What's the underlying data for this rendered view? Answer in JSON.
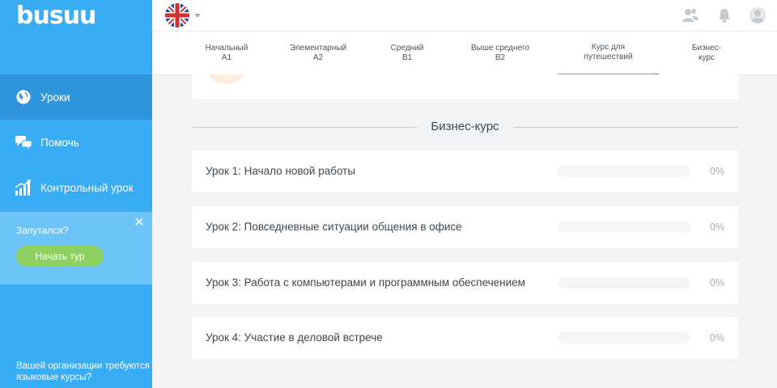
{
  "app": {
    "logo": "busuu"
  },
  "sidebar": {
    "items": [
      {
        "label": "Уроки",
        "icon": "globe-icon",
        "active": true
      },
      {
        "label": "Помочь",
        "icon": "chat-bubbles-icon",
        "active": false
      },
      {
        "label": "Контрольный урок",
        "icon": "progress-chart-icon",
        "active": false
      }
    ],
    "tour": {
      "title": "Запутался?",
      "button": "Начать тур",
      "close": "✕"
    },
    "org_link": "Вашей организации требуются языковые курсы?"
  },
  "topbar": {
    "language_flag": "uk-flag-icon",
    "icons": [
      "friends-icon",
      "bell-icon",
      "avatar-icon"
    ]
  },
  "level_tabs": [
    {
      "line1": "Начальный",
      "line2": "A1",
      "active": false
    },
    {
      "line1": "Элементарный",
      "line2": "A2",
      "active": false
    },
    {
      "line1": "Средний",
      "line2": "B1",
      "active": false
    },
    {
      "line1": "Выше среднего",
      "line2": "B2",
      "active": false
    },
    {
      "line1": "Курс для",
      "line2": "путешествий",
      "active": true
    },
    {
      "line1": "Бизнес-",
      "line2": "курс",
      "active": false
    }
  ],
  "section_title": "Бизнес-курс",
  "lessons": [
    {
      "title": "Урок 1: Начало новой работы",
      "progress_text": "0%",
      "progress": 0
    },
    {
      "title": "Урок 2: Повседневные ситуации общения в офисе",
      "progress_text": "0%",
      "progress": 0
    },
    {
      "title": "Урок 3: Работа с компьютерами и программным обеспечением",
      "progress_text": "0%",
      "progress": 0
    },
    {
      "title": "Урок 4: Участие в деловой встрече",
      "progress_text": "0%",
      "progress": 0
    }
  ],
  "colors": {
    "sidebar": "#38acf4",
    "sidebar_active": "#2f96dd",
    "tour_box": "#6cc3f7",
    "tour_button": "#8ed160",
    "tab_active_underline": "#38acf4"
  }
}
